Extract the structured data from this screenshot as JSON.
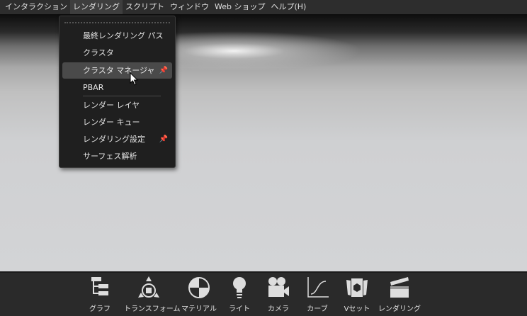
{
  "menubar": [
    "インタラクション",
    "レンダリング",
    "スクリプト",
    "ウィンドウ",
    "Web ショップ",
    "ヘルプ(H)"
  ],
  "dropdown": {
    "items": [
      {
        "label": "最終レンダリング パス",
        "pin": false
      },
      {
        "label": "クラスタ",
        "pin": false
      },
      {
        "label": "クラスタ マネージャ",
        "pin": true,
        "highlighted": true
      },
      {
        "label": "PBAR",
        "pin": false
      },
      {
        "label": "レンダー レイヤ",
        "pin": false
      },
      {
        "label": "レンダー キュー",
        "pin": false
      },
      {
        "label": "レンダリング設定",
        "pin": true
      },
      {
        "label": "サーフェス解析",
        "pin": false
      }
    ]
  },
  "toolbar": [
    "グラフ",
    "トランスフォーム",
    "マテリアル",
    "ライト",
    "カメラ",
    "カーブ",
    "Vセット",
    "レンダリング"
  ]
}
